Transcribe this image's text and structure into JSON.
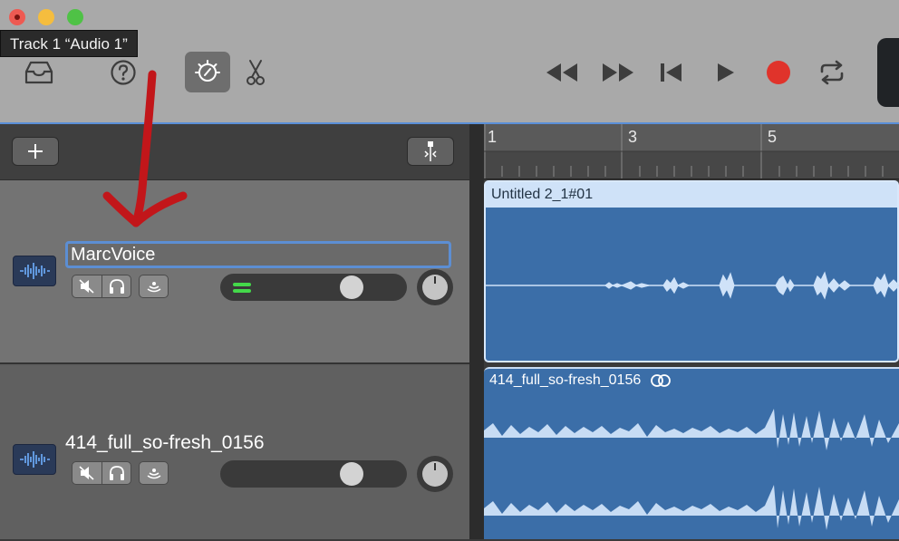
{
  "window": {
    "tooltip": "Track 1 “Audio 1”"
  },
  "toolbar": {
    "icons": [
      "library-icon",
      "help-icon",
      "smart-controls-icon",
      "editors-icon",
      "rewind-icon",
      "fast-forward-icon",
      "go-to-start-icon",
      "play-icon",
      "record-icon",
      "cycle-icon"
    ],
    "colors": {
      "record": "#e0332b",
      "accent": "#5a8fd8"
    }
  },
  "tracks": [
    {
      "name": "MarcVoice",
      "editing": true,
      "volume": 0.7
    },
    {
      "name": "414_full_so-fresh_0156",
      "editing": false,
      "volume": 0.7
    }
  ],
  "ruler": {
    "bars": [
      "1",
      "3",
      "5"
    ]
  },
  "regions": [
    {
      "title": "Untitled 2_1#01"
    },
    {
      "title": "414_full_so-fresh_0156",
      "loop_icon": "loop-icon"
    }
  ]
}
